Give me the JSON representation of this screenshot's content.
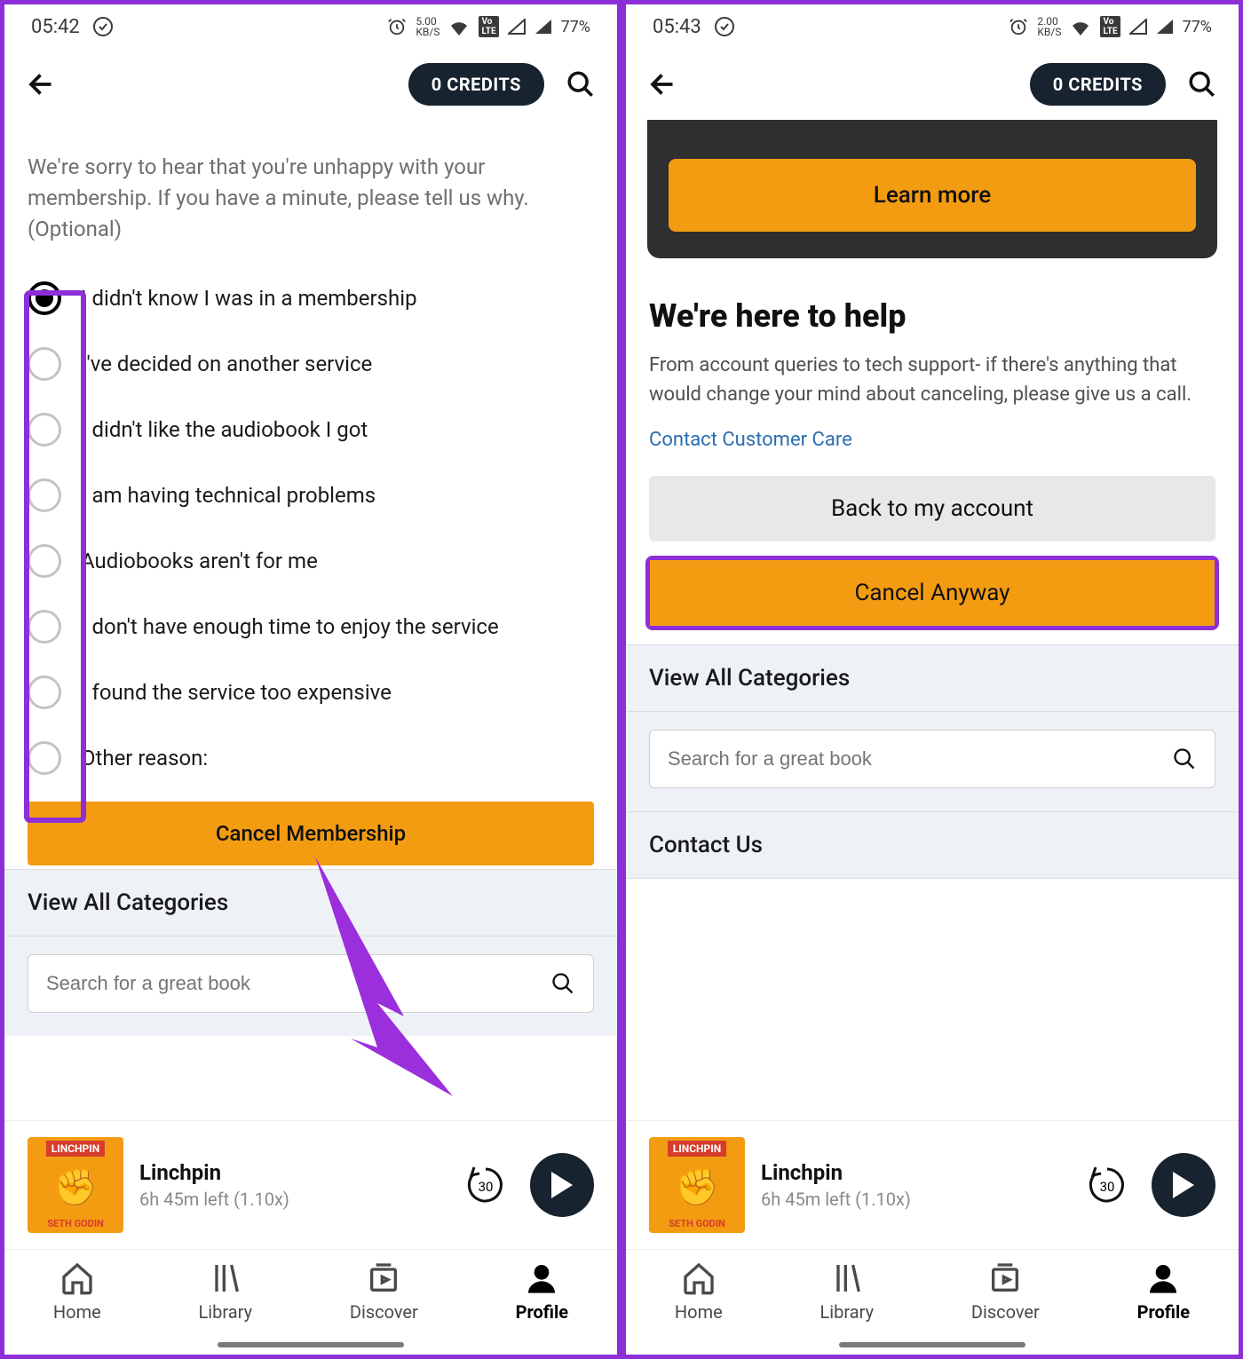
{
  "left": {
    "status": {
      "time": "05:42",
      "speed": "5.00",
      "speedUnit": "KB/S",
      "battery": "77%"
    },
    "credits": "0 CREDITS",
    "intro": "We're sorry to hear that you're unhappy with your membership. If you have a minute, please tell us why. (Optional)",
    "options": [
      "I didn't know I was in a membership",
      "I've decided on another service",
      "I didn't like the audiobook I got",
      "I am having technical problems",
      "Audiobooks aren't for me",
      "I don't have enough time to enjoy the service",
      "I found the service too expensive",
      "Other reason:"
    ],
    "selectedOption": 0,
    "cancelBtn": "Cancel Membership",
    "sectionViewAll": "View All Categories",
    "searchPlaceholder": "Search for a great book",
    "miniTitle": "Linchpin",
    "miniSub": "6h 45m left (1.10x)",
    "rewind": "30",
    "coverTop": "LINCHPIN",
    "coverBottom": "SETH GODIN",
    "nav": {
      "home": "Home",
      "library": "Library",
      "discover": "Discover",
      "profile": "Profile"
    }
  },
  "right": {
    "status": {
      "time": "05:43",
      "speed": "2.00",
      "speedUnit": "KB/S",
      "battery": "77%"
    },
    "credits": "0 CREDITS",
    "learnMore": "Learn more",
    "helpTitle": "We're here to help",
    "helpBody": "From account queries to tech support- if there's anything that would change your mind about canceling, please give us a call.",
    "contactLink": "Contact Customer Care",
    "backBtn": "Back to my account",
    "cancelAnyway": "Cancel Anyway",
    "sectionViewAll": "View All Categories",
    "searchPlaceholder": "Search for a great book",
    "sectionContact": "Contact Us",
    "miniTitle": "Linchpin",
    "miniSub": "6h 45m left (1.10x)",
    "rewind": "30",
    "coverTop": "LINCHPIN",
    "coverBottom": "SETH GODIN",
    "nav": {
      "home": "Home",
      "library": "Library",
      "discover": "Discover",
      "profile": "Profile"
    }
  }
}
